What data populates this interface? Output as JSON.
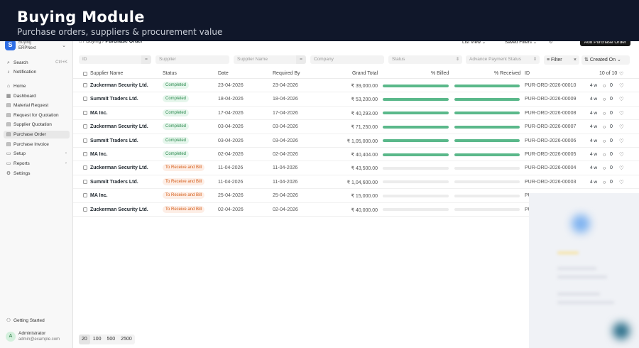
{
  "banner": {
    "title": "Buying Module",
    "subtitle": "Purchase orders, suppliers & procurement value"
  },
  "brand": {
    "name": "Buying",
    "sub": "ERPNext"
  },
  "sidebar": {
    "search": "Search",
    "search_kbd": "Ctrl+K",
    "notification": "Notification",
    "items": [
      "Home",
      "Dashboard",
      "Material Request",
      "Request for Quotation",
      "Supplier Quotation",
      "Purchase Order",
      "Purchase Invoice",
      "Setup",
      "Reports",
      "Settings"
    ],
    "getting_started": "Getting Started",
    "user_initial": "A",
    "user_name": "Administrator",
    "user_email": "admin@example.com"
  },
  "topbar": {
    "crumb_parent": "Buying",
    "crumb_current": "Purchase Order",
    "list_view": "List View",
    "saved_filters": "Saved Filters",
    "add_button": "Add Purchase Order"
  },
  "filters": {
    "id": "ID",
    "supplier": "Supplier",
    "supplier_name": "Supplier Name",
    "company": "Company",
    "status": "Status",
    "advance": "Advance Payment Status",
    "filter_btn": "Filter",
    "sort": "Created On"
  },
  "columns": {
    "supplier_name": "Supplier Name",
    "status": "Status",
    "date": "Date",
    "required_by": "Required By",
    "grand_total": "Grand Total",
    "billed": "% Billed",
    "received": "% Received",
    "id": "ID",
    "count": "10 of 10"
  },
  "rows": [
    {
      "supplier": "Zuckerman Security Ltd.",
      "status": "Completed",
      "date": "23-04-2026",
      "req": "23-04-2026",
      "total": "₹ 39,000.00",
      "billed": 1,
      "received": 1,
      "id": "PUR-ORD-2026-00010",
      "age": "4 w",
      "comments": "0"
    },
    {
      "supplier": "Summit Traders Ltd.",
      "status": "Completed",
      "date": "18-04-2026",
      "req": "18-04-2026",
      "total": "₹ 53,200.00",
      "billed": 1,
      "received": 1,
      "id": "PUR-ORD-2026-00009",
      "age": "4 w",
      "comments": "0"
    },
    {
      "supplier": "MA Inc.",
      "status": "Completed",
      "date": "17-04-2026",
      "req": "17-04-2026",
      "total": "₹ 40,293.00",
      "billed": 1,
      "received": 1,
      "id": "PUR-ORD-2026-00008",
      "age": "4 w",
      "comments": "0"
    },
    {
      "supplier": "Zuckerman Security Ltd.",
      "status": "Completed",
      "date": "03-04-2026",
      "req": "03-04-2026",
      "total": "₹ 71,250.00",
      "billed": 1,
      "received": 1,
      "id": "PUR-ORD-2026-00007",
      "age": "4 w",
      "comments": "0"
    },
    {
      "supplier": "Summit Traders Ltd.",
      "status": "Completed",
      "date": "03-04-2026",
      "req": "03-04-2026",
      "total": "₹ 1,05,000.00",
      "billed": 1,
      "received": 1,
      "id": "PUR-ORD-2026-00006",
      "age": "4 w",
      "comments": "0"
    },
    {
      "supplier": "MA Inc.",
      "status": "Completed",
      "date": "02-04-2026",
      "req": "02-04-2026",
      "total": "₹ 40,404.00",
      "billed": 1,
      "received": 1,
      "id": "PUR-ORD-2026-00005",
      "age": "4 w",
      "comments": "0"
    },
    {
      "supplier": "Zuckerman Security Ltd.",
      "status": "To Receive and Bill",
      "date": "11-04-2026",
      "req": "11-04-2026",
      "total": "₹ 43,500.00",
      "billed": 0,
      "received": 0,
      "id": "PUR-ORD-2026-00004",
      "age": "4 w",
      "comments": "0"
    },
    {
      "supplier": "Summit Traders Ltd.",
      "status": "To Receive and Bill",
      "date": "11-04-2026",
      "req": "11-04-2026",
      "total": "₹ 1,04,600.00",
      "billed": 0,
      "received": 0,
      "id": "PUR-ORD-2026-00003",
      "age": "4 w",
      "comments": "0"
    },
    {
      "supplier": "MA Inc.",
      "status": "To Receive and Bill",
      "date": "25-04-2026",
      "req": "25-04-2026",
      "total": "₹ 15,000.00",
      "billed": 0,
      "received": 0,
      "id": "PU",
      "age": "",
      "comments": ""
    },
    {
      "supplier": "Zuckerman Security Ltd.",
      "status": "To Receive and Bill",
      "date": "02-04-2026",
      "req": "02-04-2026",
      "total": "₹ 40,000.00",
      "billed": 0,
      "received": 0,
      "id": "PU",
      "age": "",
      "comments": ""
    }
  ],
  "pager": [
    "20",
    "100",
    "500",
    "2500"
  ],
  "colors": {
    "accent": "#2e6ee5",
    "progress": "#5ab88a",
    "completed": "#2b8a4e",
    "pending": "#d45a15"
  }
}
